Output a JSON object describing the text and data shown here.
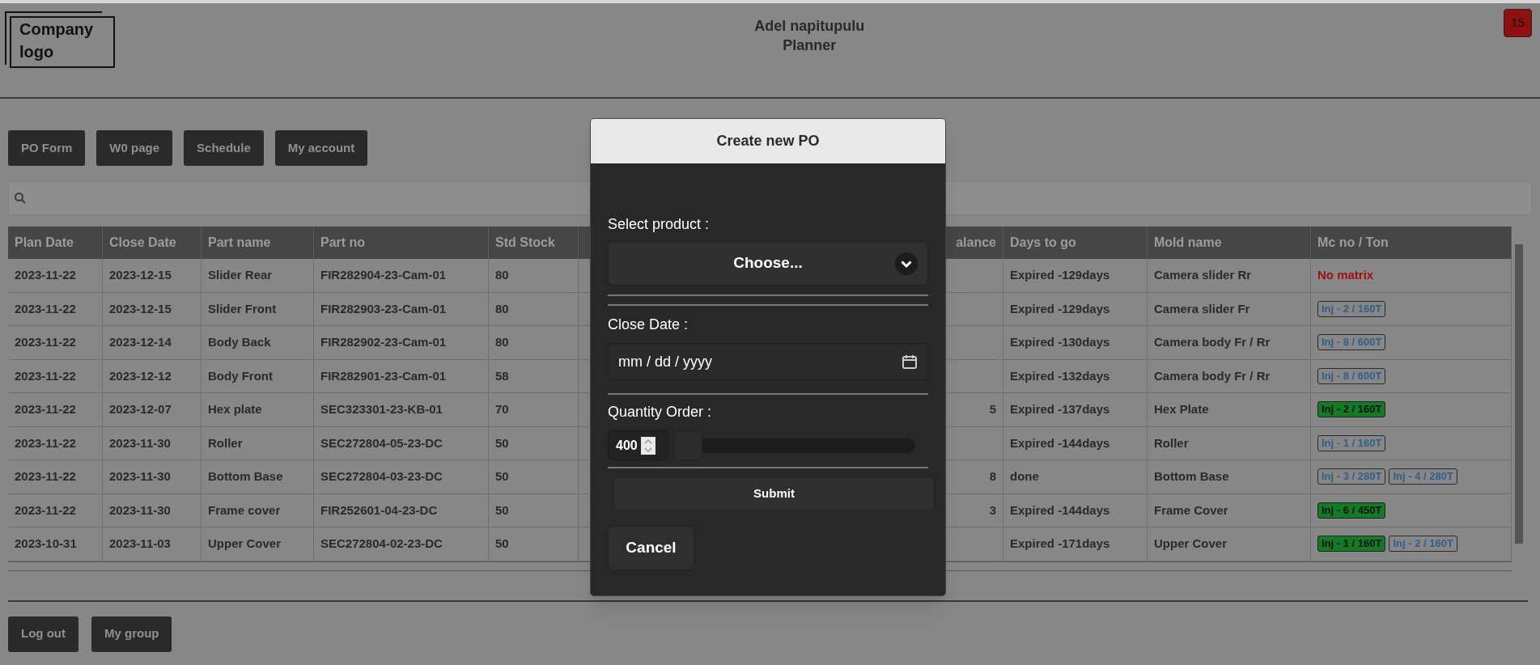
{
  "header": {
    "logo": "Company logo",
    "user": "Adel napitupulu",
    "role": "Planner",
    "notification_count": "15"
  },
  "nav": [
    "PO Form",
    "W0 page",
    "Schedule",
    "My account"
  ],
  "table": {
    "columns": [
      "Plan Date",
      "Close Date",
      "Part name",
      "Part no",
      "Std Stock",
      "",
      "alance",
      "Days to go",
      "Mold name",
      "Mc no / Ton"
    ],
    "rows": [
      {
        "cells": [
          "2023-11-22",
          "2023-12-15",
          "Slider Rear",
          "FIR282904-23-Cam-01",
          "80",
          "",
          "",
          "Expired -129days",
          "Camera slider Rr"
        ],
        "mc": [
          {
            "label": "No matrix",
            "kind": "warning"
          }
        ]
      },
      {
        "cells": [
          "2023-11-22",
          "2023-12-15",
          "Slider Front",
          "FIR282903-23-Cam-01",
          "80",
          "",
          "",
          "Expired -129days",
          "Camera slider Fr"
        ],
        "mc": [
          {
            "label": "Inj - 2 / 160T",
            "kind": "outline"
          }
        ]
      },
      {
        "cells": [
          "2023-11-22",
          "2023-12-14",
          "Body Back",
          "FIR282902-23-Cam-01",
          "80",
          "",
          "",
          "Expired -130days",
          "Camera body Fr / Rr"
        ],
        "mc": [
          {
            "label": "Inj - 8 / 600T",
            "kind": "outline"
          }
        ]
      },
      {
        "cells": [
          "2023-11-22",
          "2023-12-12",
          "Body Front",
          "FIR282901-23-Cam-01",
          "58",
          "",
          "",
          "Expired -132days",
          "Camera body Fr / Rr"
        ],
        "mc": [
          {
            "label": "Inj - 8 / 600T",
            "kind": "outline"
          }
        ]
      },
      {
        "cells": [
          "2023-11-22",
          "2023-12-07",
          "Hex plate",
          "SEC323301-23-KB-01",
          "70",
          "",
          "5",
          "Expired -137days",
          "Hex Plate"
        ],
        "mc": [
          {
            "label": "Inj - 2 / 160T",
            "kind": "active"
          }
        ]
      },
      {
        "cells": [
          "2023-11-22",
          "2023-11-30",
          "Roller",
          "SEC272804-05-23-DC",
          "50",
          "",
          "",
          "Expired -144days",
          "Roller"
        ],
        "mc": [
          {
            "label": "Inj - 1 / 160T",
            "kind": "outline"
          }
        ]
      },
      {
        "cells": [
          "2023-11-22",
          "2023-11-30",
          "Bottom Base",
          "SEC272804-03-23-DC",
          "50",
          "",
          "8",
          "done",
          "Bottom Base"
        ],
        "mc": [
          {
            "label": "Inj - 3 / 280T",
            "kind": "outline"
          },
          {
            "label": "Inj - 4 / 280T",
            "kind": "outline"
          }
        ]
      },
      {
        "cells": [
          "2023-11-22",
          "2023-11-30",
          "Frame cover",
          "FIR252601-04-23-DC",
          "50",
          "",
          "3",
          "Expired -144days",
          "Frame Cover"
        ],
        "mc": [
          {
            "label": "Inj - 6 / 450T",
            "kind": "active"
          }
        ]
      },
      {
        "cells": [
          "2023-10-31",
          "2023-11-03",
          "Upper Cover",
          "SEC272804-02-23-DC",
          "50",
          "",
          "",
          "Expired -171days",
          "Upper Cover"
        ],
        "mc": [
          {
            "label": "Inj - 1 / 160T",
            "kind": "active"
          },
          {
            "label": "Inj - 2 / 160T",
            "kind": "outline"
          }
        ]
      }
    ]
  },
  "footer": [
    "Log out",
    "My group"
  ],
  "modal": {
    "title": "Create new PO",
    "product_label": "Select product :",
    "product_value": "Choose...",
    "date_label": "Close Date :",
    "date_placeholder": "mm / dd / yyyy",
    "quantity_label": "Quantity Order :",
    "quantity_value": "400",
    "quantity_slider": {
      "level": 0
    },
    "submit": "Submit",
    "cancel": "Cancel"
  }
}
